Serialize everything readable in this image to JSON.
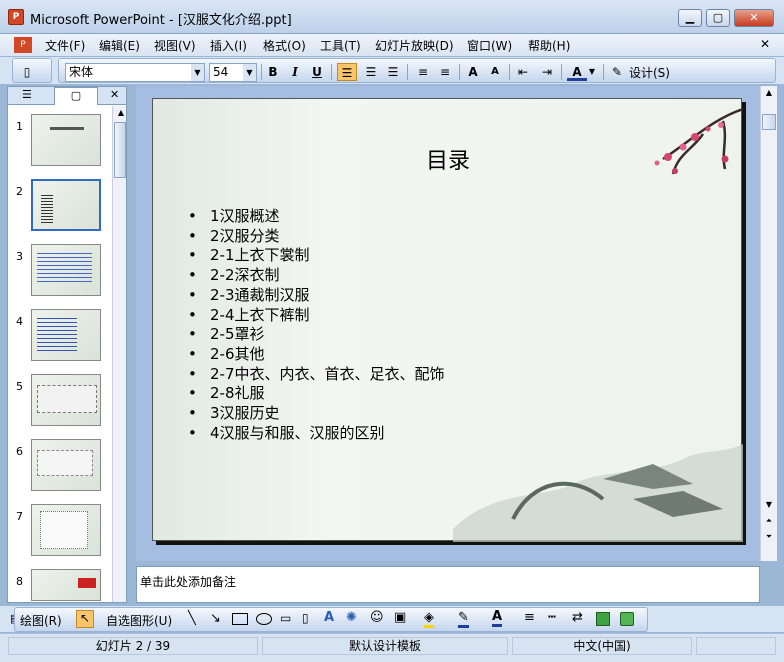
{
  "window": {
    "title": "Microsoft PowerPoint - [汉服文化介绍.ppt]",
    "app_icon": "P"
  },
  "menu": [
    "文件(F)",
    "编辑(E)",
    "视图(V)",
    "插入(I)",
    "格式(O)",
    "工具(T)",
    "幻灯片放映(D)",
    "窗口(W)",
    "帮助(H)"
  ],
  "toolbar": {
    "font_name": "宋体",
    "font_size": "54",
    "bold": "B",
    "italic": "I",
    "underline": "U",
    "design_label": "设计(S)"
  },
  "slides": [
    "1",
    "2",
    "3",
    "4",
    "5",
    "6",
    "7",
    "8"
  ],
  "slide": {
    "title": "目录",
    "bullets": [
      "1汉服概述",
      "2汉服分类",
      "2-1上衣下裳制",
      "2-2深衣制",
      "2-3通裁制汉服",
      "2-4上衣下裤制",
      "2-5罩衫",
      "2-6其他",
      "2-7中衣、内衣、首衣、足衣、配饰",
      "2-8礼服",
      "3汉服历史",
      "4汉服与和服、汉服的区别"
    ]
  },
  "notes_placeholder": "单击此处添加备注",
  "drawbar": {
    "draw_label": "绘图(R)",
    "autoshape_label": "自选图形(U)"
  },
  "status": {
    "slide_info": "幻灯片 2 / 39",
    "template": "默认设计模板",
    "language": "中文(中国)"
  },
  "colors": {
    "accent": "#316ac5",
    "chrome": "#d6e3f3"
  }
}
